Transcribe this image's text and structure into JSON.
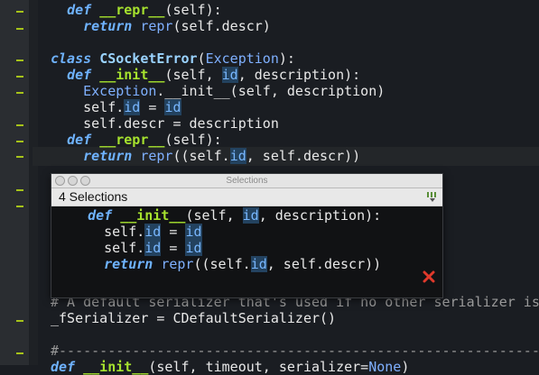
{
  "editor": {
    "lines": [
      {
        "parts": [
          {
            "t": "  "
          },
          {
            "t": "def",
            "c": "kw"
          },
          {
            "t": " "
          },
          {
            "t": "__repr__",
            "c": "fn"
          },
          {
            "t": "(self):"
          }
        ]
      },
      {
        "parts": [
          {
            "t": "    "
          },
          {
            "t": "return",
            "c": "kw"
          },
          {
            "t": " "
          },
          {
            "t": "repr",
            "c": "builtin"
          },
          {
            "t": "(self.descr)"
          }
        ]
      },
      {
        "parts": [
          {
            "t": ""
          }
        ]
      },
      {
        "parts": [
          {
            "t": "class",
            "c": "kw"
          },
          {
            "t": " "
          },
          {
            "t": "CSocketError",
            "c": "cls"
          },
          {
            "t": "("
          },
          {
            "t": "Exception",
            "c": "builtin"
          },
          {
            "t": "):"
          }
        ]
      },
      {
        "parts": [
          {
            "t": "  "
          },
          {
            "t": "def",
            "c": "kw"
          },
          {
            "t": " "
          },
          {
            "t": "__init__",
            "c": "fn"
          },
          {
            "t": "(self, "
          },
          {
            "t": "id",
            "c": "hl"
          },
          {
            "t": ", description):"
          }
        ]
      },
      {
        "parts": [
          {
            "t": "    "
          },
          {
            "t": "Exception",
            "c": "builtin"
          },
          {
            "t": ".__init__(self, description)"
          }
        ]
      },
      {
        "parts": [
          {
            "t": "    self."
          },
          {
            "t": "id",
            "c": "hl"
          },
          {
            "t": " = "
          },
          {
            "t": "id",
            "c": "hl"
          }
        ]
      },
      {
        "parts": [
          {
            "t": "    self.descr = description"
          }
        ]
      },
      {
        "parts": [
          {
            "t": "  "
          },
          {
            "t": "def",
            "c": "kw"
          },
          {
            "t": " "
          },
          {
            "t": "__repr__",
            "c": "fn"
          },
          {
            "t": "(self):"
          }
        ]
      },
      {
        "parts": [
          {
            "t": "    "
          },
          {
            "t": "return",
            "c": "kw"
          },
          {
            "t": " "
          },
          {
            "t": "repr",
            "c": "builtin"
          },
          {
            "t": "((self."
          },
          {
            "t": "id",
            "c": "hl"
          },
          {
            "t": ", self.descr))"
          }
        ]
      }
    ],
    "lower_lines": [
      {
        "parts": [
          {
            "t": "# A default serializer that's used if no other serializer is",
            "c": "comment"
          }
        ]
      },
      {
        "parts": [
          {
            "t": "_fSerializer = CDefaultSerializer()"
          }
        ]
      },
      {
        "parts": [
          {
            "t": ""
          }
        ]
      },
      {
        "parts": [
          {
            "t": "#-----------------------------------------------------------",
            "c": "comment"
          }
        ]
      },
      {
        "parts": [
          {
            "t": "def",
            "c": "kw"
          },
          {
            "t": " "
          },
          {
            "t": "__init__",
            "c": "fn"
          },
          {
            "t": "(self, timeout, serializer="
          },
          {
            "t": "None",
            "c": "builtin"
          },
          {
            "t": ")"
          }
        ]
      }
    ]
  },
  "popup": {
    "window_title": "Selections",
    "header_label": "4 Selections",
    "lines": [
      {
        "parts": [
          {
            "t": "  "
          },
          {
            "t": "def",
            "c": "kw"
          },
          {
            "t": " "
          },
          {
            "t": "__init__",
            "c": "fn"
          },
          {
            "t": "(self, "
          },
          {
            "t": "id",
            "c": "hl"
          },
          {
            "t": ", description):"
          }
        ]
      },
      {
        "parts": [
          {
            "t": "    self."
          },
          {
            "t": "id",
            "c": "hl"
          },
          {
            "t": " = "
          },
          {
            "t": "id",
            "c": "hl"
          }
        ]
      },
      {
        "parts": [
          {
            "t": "    self."
          },
          {
            "t": "id",
            "c": "hl"
          },
          {
            "t": " = "
          },
          {
            "t": "id",
            "c": "hl"
          }
        ]
      },
      {
        "parts": [
          {
            "t": "    "
          },
          {
            "t": "return",
            "c": "kw"
          },
          {
            "t": " "
          },
          {
            "t": "repr",
            "c": "builtin"
          },
          {
            "t": "((self."
          },
          {
            "t": "id",
            "c": "hl"
          },
          {
            "t": ", self.descr))"
          }
        ]
      }
    ],
    "close_icon": "close-x-icon",
    "filter_icon": "filter-menu-icon"
  },
  "colors": {
    "background": "#1a1d22",
    "keyword": "#6fb3ff",
    "function": "#a6e22e",
    "highlight_bg": "#23425f",
    "close": "#e0392b",
    "gutter_mark": "#a6c31a"
  }
}
